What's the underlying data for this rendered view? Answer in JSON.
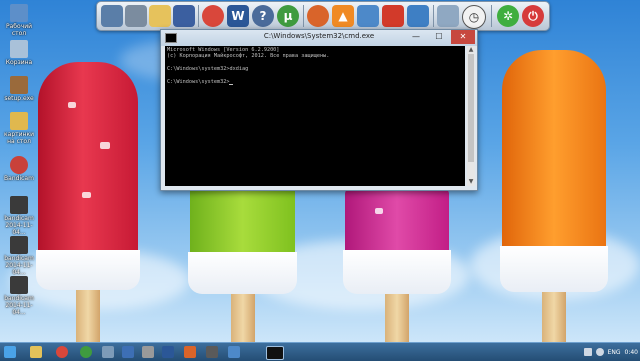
{
  "dock": {
    "items": [
      {
        "name": "computer-icon",
        "color": "#5a7ea8"
      },
      {
        "name": "drive-icon",
        "color": "#7b8c9f"
      },
      {
        "name": "documents-folder-icon",
        "color": "#e6c25c"
      },
      {
        "name": "floppy-save-icon",
        "color": "#3b5fa0"
      },
      {
        "name": "chrome-icon",
        "color": "#d9473b"
      },
      {
        "name": "word-icon",
        "color": "#2b5797"
      },
      {
        "name": "help-icon",
        "color": "#4a6b9a"
      },
      {
        "name": "utorrent-icon",
        "color": "#3f9b3f"
      },
      {
        "name": "calculator-icon",
        "color": "#d9642a"
      },
      {
        "name": "vlc-icon",
        "color": "#f08a24"
      },
      {
        "name": "network-icon",
        "color": "#4d89c9"
      },
      {
        "name": "antivirus-icon",
        "color": "#d23a2a"
      },
      {
        "name": "monitor-icon",
        "color": "#3e7fc4"
      },
      {
        "name": "recycle-bin-icon",
        "color": "#8fa8c2"
      },
      {
        "name": "clock-icon",
        "color": "#f2f2f2"
      },
      {
        "name": "settings-icon",
        "color": "#3fae3f"
      },
      {
        "name": "power-icon",
        "color": "#d63b3b"
      }
    ]
  },
  "desktop_icons": [
    {
      "label": "Рабочий стол",
      "color": "#5d8fc9"
    },
    {
      "label": "Корзина",
      "color": "#a9c1d9"
    },
    {
      "label": "setup.exe",
      "color": "#9a6a3b"
    },
    {
      "label": "картинки на стол",
      "color": "#e0b84e"
    },
    {
      "label": "Bandicam",
      "color": "#c9413a"
    },
    {
      "label": "bandicam 2014-11-04...",
      "color": "#3a3a3a"
    },
    {
      "label": "bandicam 2014-11-04...",
      "color": "#3a3a3a"
    },
    {
      "label": "bandicam 2014-11-04...",
      "color": "#3a3a3a"
    }
  ],
  "cmd": {
    "title": "C:\\Windows\\System32\\cmd.exe",
    "minimize": "—",
    "maximize": "☐",
    "close": "✕",
    "lines": [
      "Microsoft Windows [Version 6.2.9200]",
      "(c) Корпорация Майкрософт, 2012. Все права защищены.",
      "",
      "C:\\Windows\\system32>dxdiag",
      "",
      "C:\\Windows\\system32>"
    ]
  },
  "taskbar": {
    "icons": [
      {
        "name": "start-button-icon",
        "color": "#4aa3e8"
      },
      {
        "name": "explorer-icon",
        "color": "#e3c25a"
      },
      {
        "name": "chrome-taskbar-icon",
        "color": "#d9473b"
      },
      {
        "name": "utorrent-taskbar-icon",
        "color": "#3f9b3f"
      },
      {
        "name": "app-taskbar-icon",
        "color": "#7d9bb8"
      },
      {
        "name": "app-taskbar-icon",
        "color": "#3d6fb5"
      },
      {
        "name": "app-taskbar-icon",
        "color": "#9a9a9a"
      },
      {
        "name": "word-taskbar-icon",
        "color": "#2b5797"
      },
      {
        "name": "app-taskbar-icon",
        "color": "#d9642a"
      },
      {
        "name": "app-taskbar-icon",
        "color": "#5a5a5a"
      },
      {
        "name": "app-taskbar-icon",
        "color": "#4d89c9"
      },
      {
        "name": "cmd-taskbar-icon",
        "color": "#111111"
      }
    ],
    "language": "ENG",
    "time": "0:40"
  }
}
